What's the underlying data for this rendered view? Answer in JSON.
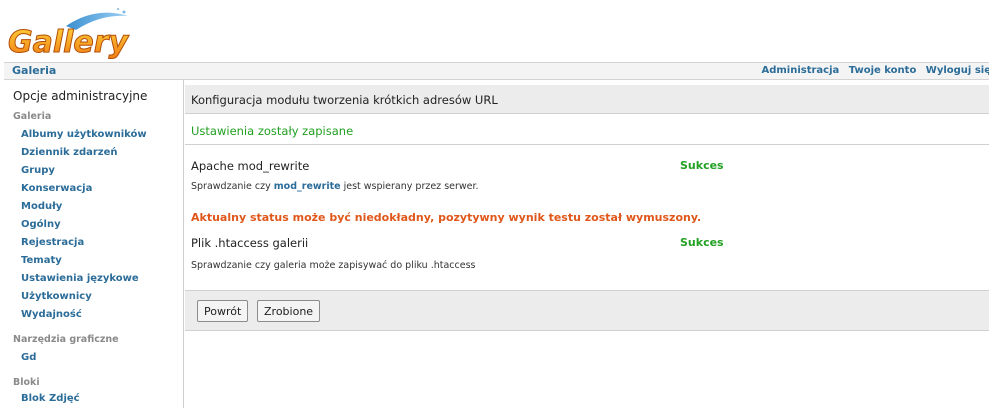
{
  "header": {
    "logo_text": "Gallery",
    "breadcrumb": "Galeria",
    "links": [
      "Administracja",
      "Twoje konto",
      "Wyloguj się"
    ]
  },
  "sidebar": {
    "title": "Opcje administracyjne",
    "groups": [
      {
        "label": "Galeria",
        "items": [
          "Albumy użytkowników",
          "Dziennik zdarzeń",
          "Grupy",
          "Konserwacja",
          "Moduły",
          "Ogólny",
          "Rejestracja",
          "Tematy",
          "Ustawienia językowe",
          "Użytkownicy",
          "Wydajność"
        ]
      },
      {
        "label": "Narzędzia graficzne",
        "items": [
          "Gd"
        ]
      },
      {
        "label": "Bloki",
        "items": [
          "Blok Zdjęć"
        ]
      }
    ]
  },
  "main": {
    "title": "Konfiguracja modułu tworzenia krótkich adresów URL",
    "saved_message": "Ustawienia zostały zapisane",
    "tests": [
      {
        "name": "Apache mod_rewrite",
        "status": "Sukces",
        "desc_pre": "Sprawdzanie czy ",
        "desc_highlight": "mod_rewrite",
        "desc_post": " jest wspierany przez serwer."
      },
      {
        "name": "Plik .htaccess galerii",
        "status": "Sukces",
        "desc_pre": "Sprawdzanie czy galeria może zapisywać do pliku .htaccess",
        "desc_highlight": "",
        "desc_post": ""
      }
    ],
    "warning": "Aktualny status może być niedokładny, pozytywny wynik testu został wymuszony.",
    "buttons": {
      "back": "Powrót",
      "done": "Zrobione"
    }
  },
  "colors": {
    "link": "#2b6c98",
    "success": "#22a022",
    "warning": "#e0571b",
    "header_bg": "#ececec"
  }
}
